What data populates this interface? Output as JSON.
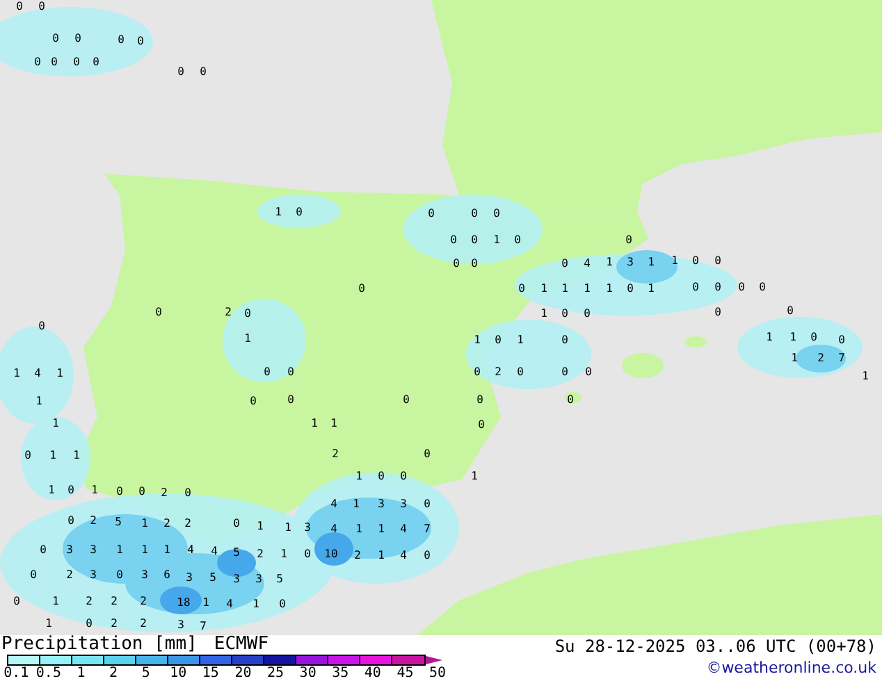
{
  "map": {
    "labels": [
      "0",
      "0",
      "0",
      "0",
      "0",
      "0",
      "0",
      "0",
      "0",
      "0",
      "0",
      "0",
      "1",
      "0",
      "0",
      "0",
      "0",
      "0",
      "0",
      "1",
      "0",
      "0",
      "0",
      "0",
      "0",
      "4",
      "1",
      "3",
      "1",
      "1",
      "0",
      "0",
      "0",
      "0",
      "1",
      "1",
      "1",
      "1",
      "0",
      "1",
      "0",
      "0",
      "0",
      "0",
      "0",
      "2",
      "0",
      "1",
      "0",
      "0",
      "0",
      "0",
      "0",
      "1",
      "1",
      "0",
      "1",
      "0",
      "1",
      "1",
      "0",
      "0",
      "1",
      "2",
      "7",
      "1",
      "4",
      "1",
      "0",
      "0",
      "0",
      "2",
      "0",
      "0",
      "0",
      "1",
      "1",
      "0",
      "0",
      "0",
      "0",
      "0",
      "1",
      "1",
      "1",
      "0",
      "0",
      "1",
      "1",
      "2",
      "0",
      "1",
      "0",
      "0",
      "1",
      "1",
      "0",
      "1",
      "0",
      "0",
      "2",
      "0",
      "4",
      "1",
      "3",
      "3",
      "0",
      "0",
      "2",
      "5",
      "1",
      "2",
      "2",
      "0",
      "1",
      "1",
      "3",
      "4",
      "1",
      "1",
      "4",
      "7",
      "0",
      "3",
      "3",
      "1",
      "1",
      "1",
      "4",
      "4",
      "5",
      "2",
      "1",
      "0",
      "10",
      "2",
      "1",
      "4",
      "0",
      "0",
      "2",
      "3",
      "0",
      "3",
      "6",
      "3",
      "5",
      "3",
      "3",
      "5",
      "0",
      "1",
      "2",
      "2",
      "2",
      "18",
      "1",
      "4",
      "1",
      "0",
      "1",
      "0",
      "2",
      "2",
      "3",
      "7"
    ]
  },
  "legend": {
    "title": "Precipitation [mm]",
    "model": "ECMWF",
    "swatches": [
      {
        "color": "#b4f8f8"
      },
      {
        "color": "#96f2f8"
      },
      {
        "color": "#78e6f0"
      },
      {
        "color": "#5ad2ee"
      },
      {
        "color": "#46b4ea"
      },
      {
        "color": "#3c96e6"
      },
      {
        "color": "#3264e6"
      },
      {
        "color": "#2840c8"
      },
      {
        "color": "#1414a0"
      },
      {
        "color": "#9614dc"
      },
      {
        "color": "#c814e6"
      },
      {
        "color": "#e614dc"
      },
      {
        "color": "#c814a0"
      }
    ],
    "ticks": [
      "0.1",
      "0.5",
      "1",
      "2",
      "5",
      "10",
      "15",
      "20",
      "25",
      "30",
      "35",
      "40",
      "45",
      "50"
    ]
  },
  "valid_time": "Su 28-12-2025 03..06 UTC (00+78)",
  "credit": "©weatheronline.co.uk"
}
